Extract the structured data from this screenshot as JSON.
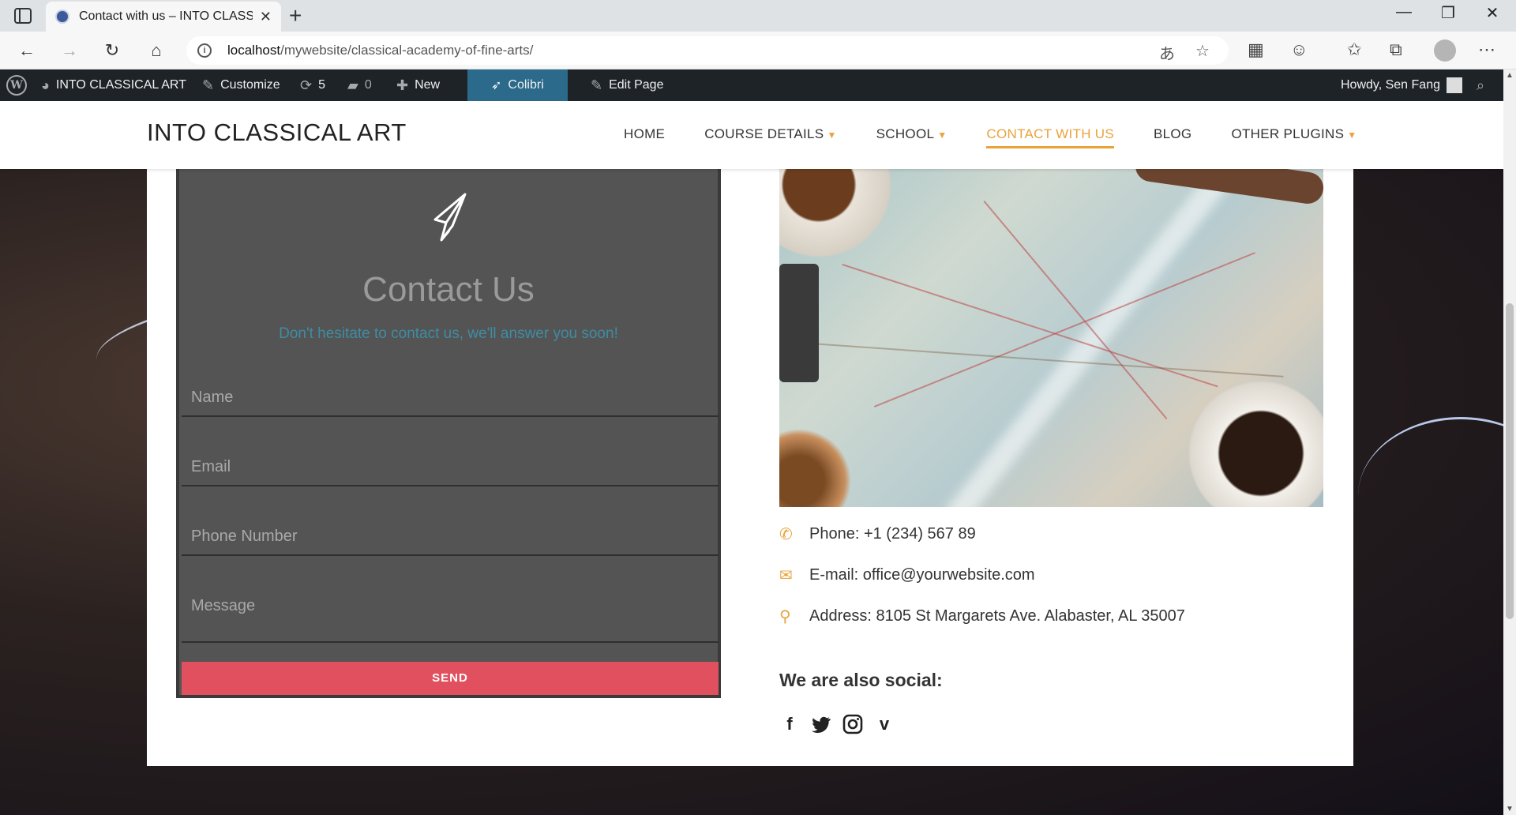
{
  "browser": {
    "tab_title": "Contact with us – INTO CLASSICAL ART",
    "url_host": "localhost",
    "url_path": "/mywebsite/classical-academy-of-fine-arts/",
    "minimize": "—",
    "restore": "❐",
    "close": "✕"
  },
  "adminbar": {
    "site_name": "INTO CLASSICAL ART",
    "customize": "Customize",
    "updates_count": "5",
    "comments_count": "0",
    "new_label": "New",
    "colibri_label": "Colibri",
    "edit_page": "Edit Page",
    "howdy": "Howdy, Sen Fang"
  },
  "site": {
    "logo": "INTO CLASSICAL ART",
    "menu": [
      {
        "label": "HOME",
        "has_caret": false,
        "active": false
      },
      {
        "label": "COURSE DETAILS",
        "has_caret": true,
        "active": false
      },
      {
        "label": "SCHOOL",
        "has_caret": true,
        "active": false
      },
      {
        "label": "CONTACT WITH US",
        "has_caret": false,
        "active": true
      },
      {
        "label": "BLOG",
        "has_caret": false,
        "active": false
      },
      {
        "label": "OTHER PLUGINS",
        "has_caret": true,
        "active": false
      }
    ]
  },
  "form": {
    "title": "Contact Us",
    "subtitle": "Don't hesitate to contact us, we'll answer you soon!",
    "name_placeholder": "Name",
    "email_placeholder": "Email",
    "phone_placeholder": "Phone Number",
    "message_placeholder": "Message",
    "send_label": "SEND"
  },
  "contact": {
    "phone": "Phone: +1 (234) 567 89",
    "email": "E-mail: office@yourwebsite.com",
    "address": "Address: 8105 St Margarets Ave. Alabaster, AL 35007",
    "social_title": "We are also social:",
    "social_icons": [
      "facebook-icon",
      "twitter-icon",
      "instagram-icon",
      "vimeo-icon"
    ]
  },
  "colors": {
    "accent": "#e8a33d",
    "send_button": "#e0505e",
    "form_bg": "#545454",
    "admin_bar": "#1d2327"
  }
}
